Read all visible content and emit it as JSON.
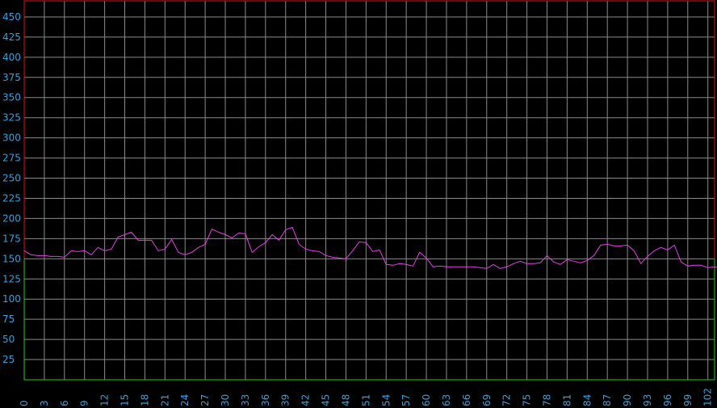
{
  "chart_data": {
    "type": "line",
    "title": "",
    "xlabel": "",
    "ylabel": "",
    "xlim": [
      0,
      103
    ],
    "ylim": [
      0,
      470
    ],
    "y_ticks": [
      25,
      50,
      75,
      100,
      125,
      150,
      175,
      200,
      225,
      250,
      275,
      300,
      325,
      350,
      375,
      400,
      425,
      450
    ],
    "x_ticks": [
      0,
      3,
      6,
      9,
      12,
      15,
      18,
      21,
      24,
      27,
      30,
      33,
      36,
      39,
      42,
      45,
      48,
      51,
      54,
      57,
      60,
      63,
      66,
      69,
      72,
      75,
      78,
      81,
      84,
      87,
      90,
      93,
      96,
      99,
      102
    ],
    "grid": true,
    "upper_limit": 470,
    "lower_limit": 150,
    "colors": {
      "background": "#000000",
      "grid": "#8a8a8a",
      "line": "#e63ee6",
      "upper_band": "#e01010",
      "lower_band": "#22cc22",
      "ticks": "#3a9fd8"
    },
    "series": [
      {
        "values": [
          160,
          155,
          154,
          154,
          153,
          153,
          152,
          160,
          159,
          160,
          155,
          164,
          160,
          162,
          177,
          180,
          183,
          173,
          173,
          173,
          160,
          162,
          174,
          158,
          155,
          158,
          164,
          168,
          187,
          183,
          180,
          176,
          182,
          181,
          158,
          165,
          170,
          180,
          173,
          186,
          189,
          168,
          162,
          160,
          159,
          154,
          152,
          151,
          150,
          160,
          171,
          170,
          159,
          161,
          143,
          142,
          144,
          143,
          141,
          158,
          151,
          140,
          141,
          140,
          140,
          140,
          140,
          140,
          139,
          138,
          143,
          138,
          140,
          144,
          147,
          144,
          144,
          145,
          154,
          146,
          143,
          149,
          147,
          145,
          148,
          154,
          167,
          168,
          166,
          166,
          167,
          160,
          144,
          153,
          160,
          164,
          161,
          167,
          146,
          141,
          142,
          142,
          139,
          140,
          138
        ]
      }
    ]
  }
}
